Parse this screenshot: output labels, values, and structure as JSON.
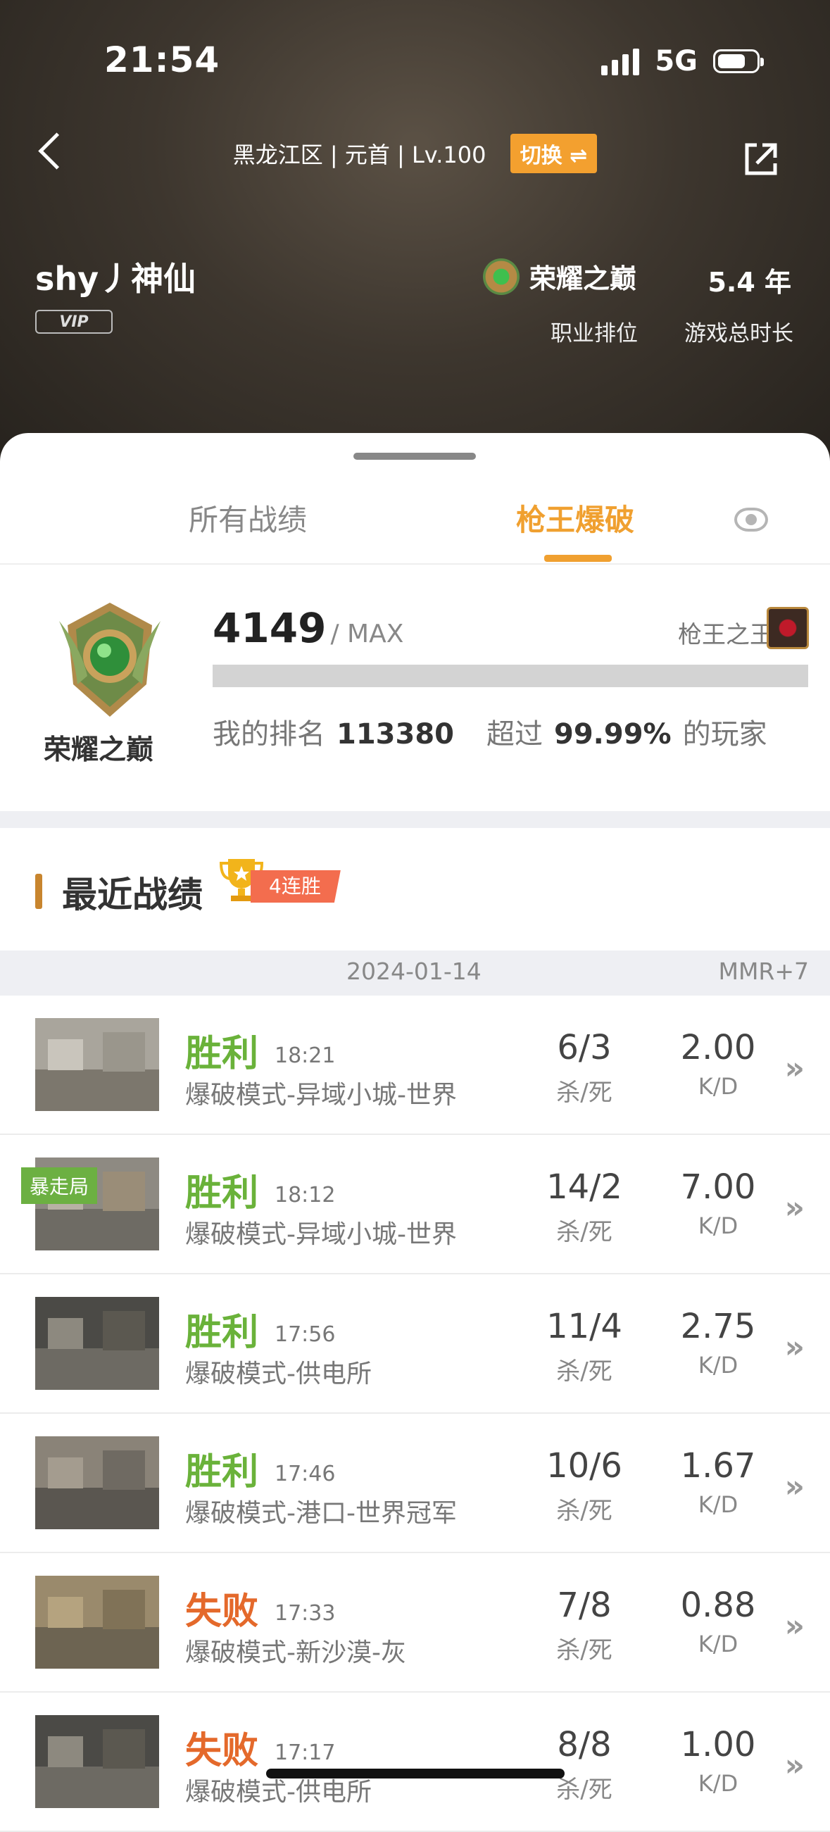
{
  "status_bar": {
    "time": "21:54",
    "network": "5G",
    "battery_level": 0.7
  },
  "header": {
    "info": "黑龙江区 | 元首 | Lv.100",
    "switch_label": "切换 ⇌",
    "user_name": "shy丿神仙",
    "vip_label": "VIP",
    "rank_title": "荣耀之巅",
    "rank_label": "职业排位",
    "years": "5.4 年",
    "years_label": "游戏总时长"
  },
  "tabs": {
    "all": "所有战绩",
    "gun_king": "枪王爆破"
  },
  "rank_card": {
    "rank_name": "荣耀之巅",
    "score": "4149",
    "score_max": "/ MAX",
    "king_label": "枪王之王",
    "progress": 1.0,
    "my_rank_label": "我的排名",
    "my_rank": "113380",
    "exceed_label": "超过",
    "exceed_pct": "99.99%",
    "players_label": "的玩家"
  },
  "recent": {
    "title": "最近战绩",
    "streak": "4连胜"
  },
  "date_row": {
    "date": "2024-01-14",
    "mmr": "MMR+7"
  },
  "matches": [
    {
      "result": "胜利",
      "outcome": "win",
      "time": "18:21",
      "mode": "爆破模式-异域小城-世界",
      "score": "6/3",
      "score_label": "杀/死",
      "kd": "2.00",
      "kd_label": "K/D",
      "tag": ""
    },
    {
      "result": "胜利",
      "outcome": "win",
      "time": "18:12",
      "mode": "爆破模式-异域小城-世界",
      "score": "14/2",
      "score_label": "杀/死",
      "kd": "7.00",
      "kd_label": "K/D",
      "tag": "暴走局"
    },
    {
      "result": "胜利",
      "outcome": "win",
      "time": "17:56",
      "mode": "爆破模式-供电所",
      "score": "11/4",
      "score_label": "杀/死",
      "kd": "2.75",
      "kd_label": "K/D",
      "tag": ""
    },
    {
      "result": "胜利",
      "outcome": "win",
      "time": "17:46",
      "mode": "爆破模式-港口-世界冠军",
      "score": "10/6",
      "score_label": "杀/死",
      "kd": "1.67",
      "kd_label": "K/D",
      "tag": ""
    },
    {
      "result": "失败",
      "outcome": "lose",
      "time": "17:33",
      "mode": "爆破模式-新沙漠-灰",
      "score": "7/8",
      "score_label": "杀/死",
      "kd": "0.88",
      "kd_label": "K/D",
      "tag": ""
    },
    {
      "result": "失败",
      "outcome": "lose",
      "time": "17:17",
      "mode": "爆破模式-供电所",
      "score": "8/8",
      "score_label": "杀/死",
      "kd": "1.00",
      "kd_label": "K/D",
      "tag": ""
    }
  ],
  "colors": {
    "accent": "#f0a030",
    "win": "#6ab23a",
    "lose": "#e4692b",
    "streak": "#f36d4e"
  },
  "icons": [
    "back-icon",
    "share-icon",
    "eye-icon",
    "trophy-icon",
    "chevron-right-icon"
  ]
}
